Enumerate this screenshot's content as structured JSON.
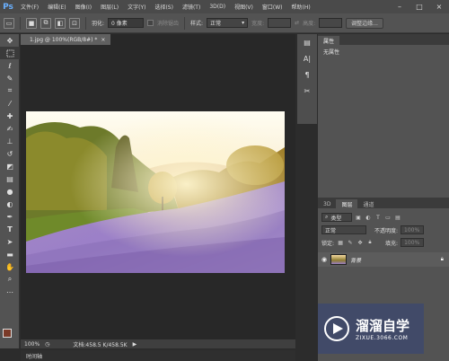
{
  "app": {
    "logo": "Ps",
    "window_controls": [
      "–",
      "□",
      "×"
    ]
  },
  "menu": [
    "文件(F)",
    "编辑(E)",
    "图像(I)",
    "图层(L)",
    "文字(Y)",
    "选择(S)",
    "滤镜(T)",
    "3D(D)",
    "视图(V)",
    "窗口(W)",
    "帮助(H)"
  ],
  "options": {
    "feather_label": "羽化:",
    "feather_value": "0 像素",
    "antialias_label": "消除锯齿",
    "style_label": "样式:",
    "style_value": "正常",
    "width_label": "宽度:",
    "height_label": "高度:",
    "refine_edge": "调整边缘..."
  },
  "document": {
    "tab_title": "1.jpg @ 100%(RGB/8#) *",
    "zoom": "100%",
    "doc_info": "文档:458.5 K/458.5K",
    "timeline_tab": "时间轴"
  },
  "properties": {
    "tab": "属性",
    "no_properties": "无属性"
  },
  "layers": {
    "tabs": [
      "3D",
      "图层",
      "通道"
    ],
    "filter_label": "类型",
    "blend_mode": "正常",
    "opacity_label": "不透明度:",
    "opacity_value": "100%",
    "lock_label": "锁定:",
    "fill_label": "填充:",
    "fill_value": "100%",
    "layer_name": "背景"
  },
  "watermark": {
    "brand": "溜溜自学",
    "url": "ZIXUE.3066.COM"
  }
}
